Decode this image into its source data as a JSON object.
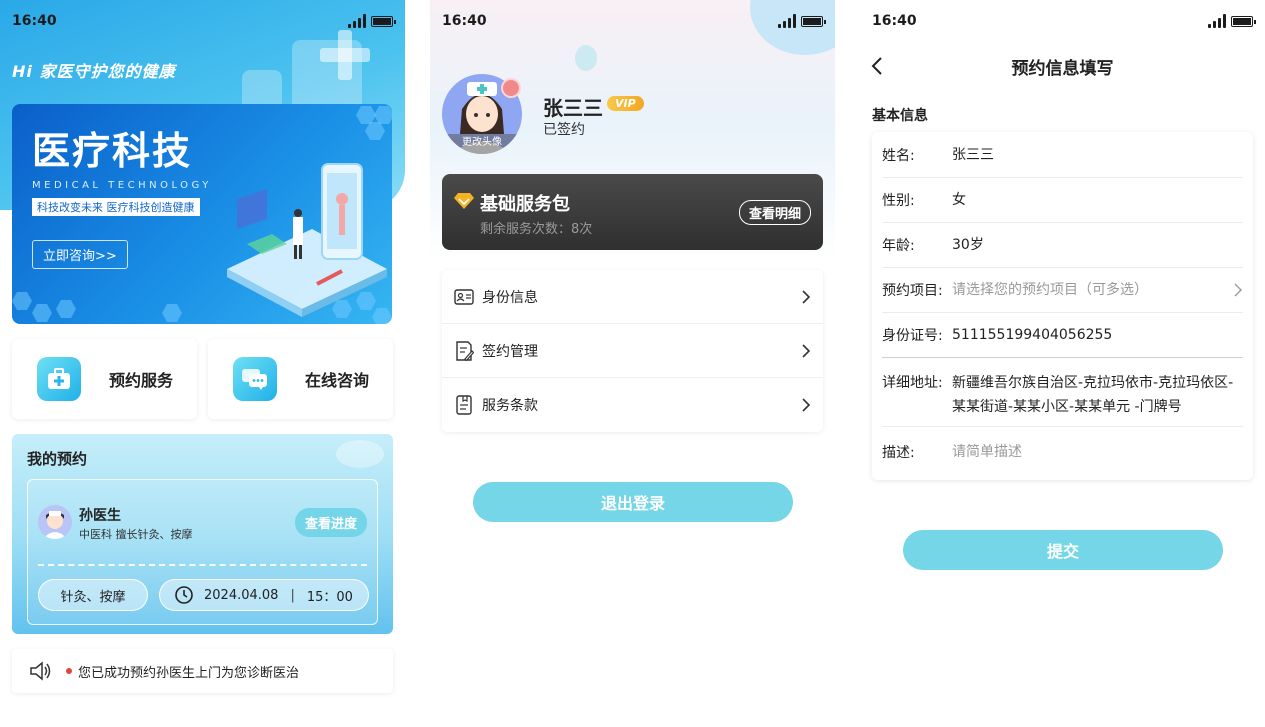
{
  "status_time": "16:40",
  "home": {
    "slogan": "Hi 家医守护您的健康",
    "banner": {
      "title": "医疗科技",
      "subtitle_en": "MEDICAL TECHNOLOGY",
      "tagline": "科技改变未来 医疗科技创造健康",
      "button": "立即咨询>>"
    },
    "services": [
      {
        "label": "预约服务",
        "icon": "medical-kit-icon"
      },
      {
        "label": "在线咨询",
        "icon": "chat-bubbles-icon"
      }
    ],
    "appointment": {
      "section_title": "我的预约",
      "doctor_name": "孙医生",
      "doctor_desc": "中医科  擅长针灸、按摩",
      "progress_button": "查看进度",
      "service_tag": "针灸、按摩",
      "date": "2024.04.08",
      "time": "15：00"
    },
    "notice": "您已成功预约孙医生上门为您诊断医治"
  },
  "profile": {
    "avatar_caption": "更改头像",
    "name": "张三三",
    "vip_badge": "VIP",
    "status": "已签约",
    "package": {
      "title": "基础服务包",
      "remaining": "剩余服务次数：8次",
      "details_button": "查看明细"
    },
    "menu": [
      {
        "label": "身份信息",
        "icon": "id-card-icon"
      },
      {
        "label": "签约管理",
        "icon": "contract-edit-icon"
      },
      {
        "label": "服务条款",
        "icon": "document-icon"
      }
    ],
    "logout_button": "退出登录"
  },
  "form": {
    "title": "预约信息填写",
    "section": "基本信息",
    "fields": [
      {
        "label": "姓名:",
        "value": "张三三"
      },
      {
        "label": "性别:",
        "value": "女"
      },
      {
        "label": "年龄:",
        "value": "30岁"
      },
      {
        "label": "预约项目:",
        "value": "",
        "placeholder": "请选择您的预约项目（可多选）"
      },
      {
        "label": "身份证号:",
        "value": "511155199404056255"
      },
      {
        "label": "详细地址:",
        "value": "新疆维吾尔族自治区-克拉玛依市-克拉玛依区-某某街道-某某小区-某某单元 -门牌号"
      },
      {
        "label": "描述:",
        "value": "",
        "placeholder": "请简单描述"
      }
    ],
    "submit_button": "提交"
  },
  "colors": {
    "accent": "#74d6e6",
    "hero_blue": "#2aa8e8",
    "package_dark": "#3a3a3a",
    "vip_gold": "#f4a623"
  }
}
